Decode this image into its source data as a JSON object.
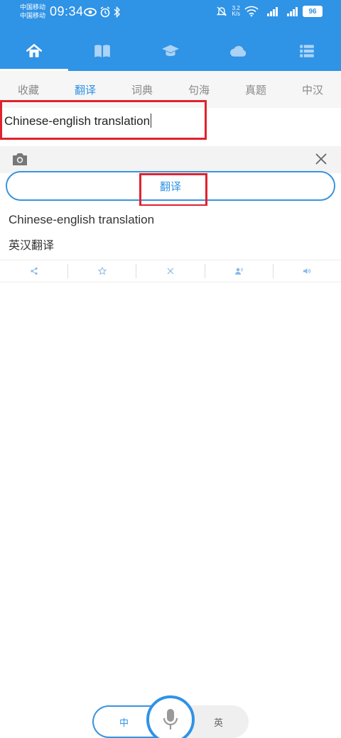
{
  "status_bar": {
    "carrier1": "中国移动",
    "carrier2": "中国移动",
    "time": "09:34",
    "speed_value": "3.2",
    "speed_unit": "K/s",
    "battery": "96"
  },
  "nav": {
    "tabs": [
      {
        "icon": "home-icon",
        "active": true
      },
      {
        "icon": "book-icon",
        "active": false
      },
      {
        "icon": "graduation-cap-icon",
        "active": false
      },
      {
        "icon": "cloud-icon",
        "active": false
      },
      {
        "icon": "list-icon",
        "active": false
      }
    ]
  },
  "subtabs": [
    "收藏",
    "翻译",
    "词典",
    "句海",
    "真题",
    "中汉"
  ],
  "subtab_active_index": 1,
  "input": {
    "value": "Chinese-english translation"
  },
  "translate_button": "翻译",
  "result": {
    "source": "Chinese-english translation",
    "translation": "英汉翻译"
  },
  "result_actions": [
    "share-icon",
    "star-icon",
    "close-icon",
    "speaker-person-icon",
    "volume-icon"
  ],
  "language_switch": {
    "left": "中",
    "right": "英"
  },
  "colors": {
    "primary": "#2f93e6",
    "highlight": "#e0222d"
  }
}
